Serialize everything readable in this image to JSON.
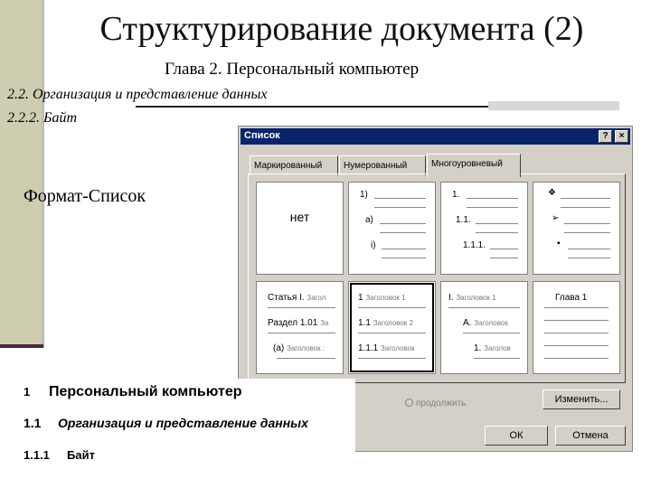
{
  "slide": {
    "title": "Структурирование документа (2)",
    "subtitle": "Глава 2. Персональный компьютер",
    "line1": "2.2. Организация и представление данных",
    "line2": "2.2.2. Байт",
    "format_label": "Формат-Список"
  },
  "dialog": {
    "title": "Список",
    "help_icon": "?",
    "close_icon": "×",
    "tabs": [
      "Маркированный",
      "Нумерованный",
      "Многоуровневый"
    ],
    "active_tab": "Многоуровневый",
    "none_label": "нет",
    "cells": {
      "c2": [
        "1)",
        "a)",
        "i)"
      ],
      "c3": [
        "1.",
        "1.1.",
        "1.1.1."
      ],
      "c4": [
        "❖",
        "➢",
        "▪"
      ],
      "c5": [
        [
          "Статья I.",
          "Загол"
        ],
        [
          "Раздел 1.01",
          "За"
        ],
        [
          "(a)",
          "Заголовок :"
        ]
      ],
      "c6": [
        [
          "1",
          "Заголовок 1"
        ],
        [
          "1.1",
          "Заголовок 2"
        ],
        [
          "1.1.1",
          "Заголовок"
        ]
      ],
      "c7": [
        [
          "I.",
          "Заголовок 1"
        ],
        [
          "A.",
          "Заголовок"
        ],
        [
          "1.",
          "Заголов"
        ]
      ],
      "c8": [
        "Глава 1"
      ]
    },
    "continue_label": "продолжить",
    "change_button": "Изменить...",
    "ok_button": "ОК",
    "cancel_button": "Отмена"
  },
  "preview": {
    "l1_num": "1",
    "l1_text": "Персональный компьютер",
    "l2_num": "1.1",
    "l2_text": "Организация и представление данных",
    "l3_num": "1.1.1",
    "l3_text": "Байт"
  }
}
